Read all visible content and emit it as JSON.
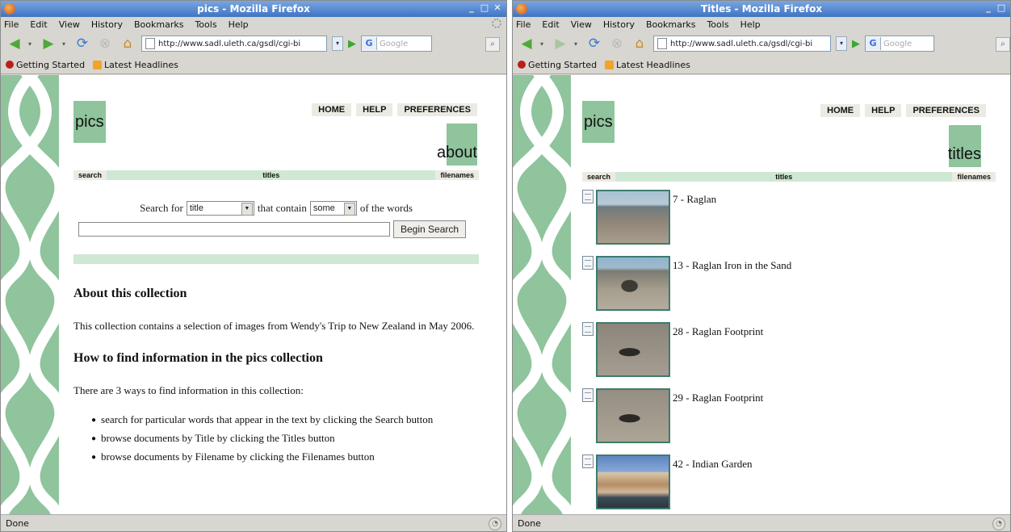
{
  "left": {
    "window_title": "pics - Mozilla Firefox",
    "menu": [
      "File",
      "Edit",
      "View",
      "History",
      "Bookmarks",
      "Tools",
      "Help"
    ],
    "url": "http://www.sadl.uleth.ca/gsdl/cgi-bi",
    "search_placeholder": "Google",
    "bookmarks": [
      "Getting Started",
      "Latest Headlines"
    ],
    "logo": "pics",
    "nav": [
      "HOME",
      "HELP",
      "PREFERENCES"
    ],
    "page_label": "about",
    "tabs": [
      "search",
      "titles",
      "filenames"
    ],
    "search": {
      "label_before": "Search for",
      "field_value": "title",
      "label_middle": "that contain",
      "mode_value": "some",
      "label_after": "of the words",
      "button": "Begin Search"
    },
    "about": {
      "heading1": "About this collection",
      "para1": "This collection contains a selection of images from Wendy's Trip to New Zealand in May 2006.",
      "heading2": "How to find information in the pics collection",
      "para2": "There are 3 ways to find information in this collection:",
      "ways": [
        "search for particular words that appear in the text by clicking the Search button",
        "browse documents by Title by clicking the Titles button",
        "browse documents by Filename by clicking the Filenames button"
      ]
    },
    "status": "Done"
  },
  "right": {
    "window_title": "Titles - Mozilla Firefox",
    "menu": [
      "File",
      "Edit",
      "View",
      "History",
      "Bookmarks",
      "Tools",
      "Help"
    ],
    "url": "http://www.sadl.uleth.ca/gsdl/cgi-bi",
    "search_placeholder": "Google",
    "bookmarks": [
      "Getting Started",
      "Latest Headlines"
    ],
    "logo": "pics",
    "nav": [
      "HOME",
      "HELP",
      "PREFERENCES"
    ],
    "page_label": "titles",
    "tabs": [
      "search",
      "titles",
      "filenames"
    ],
    "results": [
      {
        "title": "7 - Raglan"
      },
      {
        "title": "13 - Raglan Iron in the Sand"
      },
      {
        "title": "28 - Raglan Footprint"
      },
      {
        "title": "29 - Raglan Footprint"
      },
      {
        "title": "42 - Indian Garden"
      }
    ],
    "status": "Done"
  },
  "colors": {
    "greenstone_green": "#8fc49c",
    "tab_green": "#cfe8d3",
    "nav_bg": "#ecebe3",
    "titlebar_blue": "#3f74c4"
  }
}
